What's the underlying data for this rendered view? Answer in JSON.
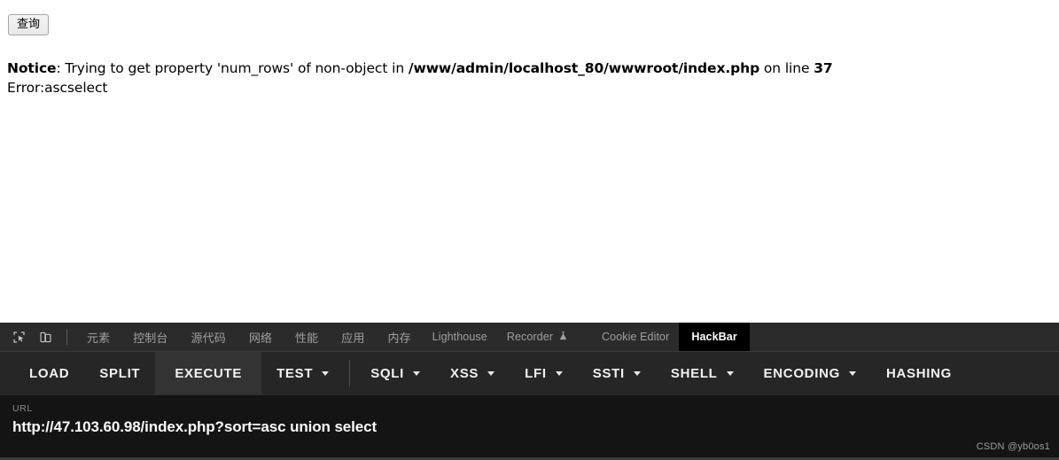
{
  "page": {
    "query_button_label": "查询",
    "notice": {
      "prefix_bold": "Notice",
      "middle": ": Trying to get property 'num_rows' of non-object in ",
      "path_bold": "/www/admin/localhost_80/wwwroot/index.php",
      "on_line": " on line ",
      "line_number_bold": "37",
      "second_line": "Error:ascselect"
    }
  },
  "devtools": {
    "icons": {
      "inspect": "inspect-element-icon",
      "device": "device-toolbar-icon"
    },
    "tabs": [
      {
        "label": "元素",
        "cjk": true,
        "active": false
      },
      {
        "label": "控制台",
        "cjk": true,
        "active": false
      },
      {
        "label": "源代码",
        "cjk": true,
        "active": false
      },
      {
        "label": "网络",
        "cjk": true,
        "active": false
      },
      {
        "label": "性能",
        "cjk": true,
        "active": false
      },
      {
        "label": "应用",
        "cjk": true,
        "active": false
      },
      {
        "label": "内存",
        "cjk": true,
        "active": false
      },
      {
        "label": "Lighthouse",
        "cjk": false,
        "active": false
      },
      {
        "label": "Recorder",
        "cjk": false,
        "active": false,
        "icon": "flask-icon"
      },
      {
        "label": "Cookie Editor",
        "cjk": false,
        "active": false
      },
      {
        "label": "HackBar",
        "cjk": false,
        "active": true
      }
    ]
  },
  "hackbar": {
    "menu": [
      {
        "label": "LOAD",
        "caret": false,
        "hovered": false
      },
      {
        "label": "SPLIT",
        "caret": false,
        "hovered": false
      },
      {
        "label": "EXECUTE",
        "caret": false,
        "hovered": true
      },
      {
        "label": "TEST",
        "caret": true,
        "hovered": false
      },
      {
        "label": "SQLI",
        "caret": true,
        "hovered": false
      },
      {
        "label": "XSS",
        "caret": true,
        "hovered": false
      },
      {
        "label": "LFI",
        "caret": true,
        "hovered": false
      },
      {
        "label": "SSTI",
        "caret": true,
        "hovered": false
      },
      {
        "label": "SHELL",
        "caret": true,
        "hovered": false
      },
      {
        "label": "ENCODING",
        "caret": true,
        "hovered": false
      },
      {
        "label": "HASHING",
        "caret": false,
        "hovered": false
      }
    ],
    "url": {
      "label": "URL",
      "value": "http://47.103.60.98/index.php?sort=asc union select"
    }
  },
  "watermark": "CSDN @yb0os1",
  "colors": {
    "page_bg": "#ffffff",
    "devtools_bg": "#2b2b2b",
    "hackbar_menu_bg": "#262626",
    "url_panel_bg": "#141414",
    "active_tab_bg": "#000000",
    "tab_text": "#9aa0a6"
  }
}
